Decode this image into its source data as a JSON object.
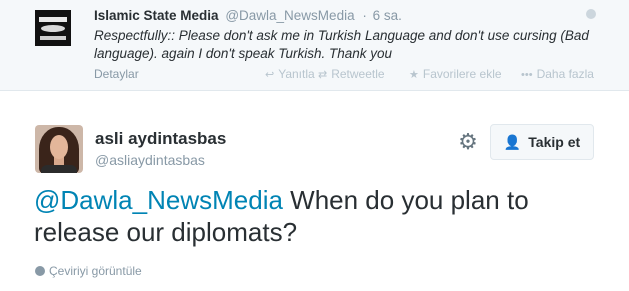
{
  "quoted_tweet": {
    "name": "Islamic State Media",
    "handle": "@Dawla_NewsMedia",
    "separator": "·",
    "time": "6 sa.",
    "text": "Respectfully:: Please don't ask me in Turkish Language and don't use cursing (Bad language). again I don't speak Turkish. Thank you",
    "details_label": "Detaylar",
    "actions": {
      "reply": "Yanıtla",
      "retweet": "Retweetle",
      "favorite": "Favorilere ekle",
      "more": "Daha fazla"
    }
  },
  "main_tweet": {
    "name": "asli aydintasbas",
    "handle": "@asliaydintasbas",
    "follow_label": "Takip et",
    "mention": "@Dawla_NewsMedia",
    "text": " When do you plan to release our diplomats?",
    "translate_label": "Çeviriyi görüntüle"
  },
  "icons": {
    "settings": "gear-icon",
    "follow": "add-user-icon",
    "reply": "reply-icon",
    "retweet": "retweet-icon",
    "favorite": "star-icon",
    "more": "more-icon",
    "translate": "globe-icon"
  },
  "colors": {
    "link": "#0084b4",
    "muted": "#8899a6",
    "follow_icon": "#55acee",
    "quoted_background": "#f5f8fa"
  }
}
